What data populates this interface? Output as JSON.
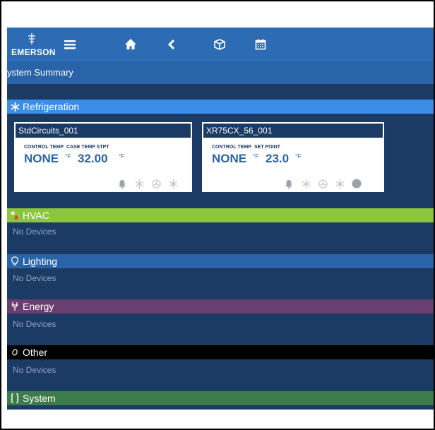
{
  "brand": {
    "name": "EMERSON"
  },
  "topbar": {
    "icons": [
      "menu-icon",
      "home-icon",
      "back-icon",
      "box-icon",
      "calendar-icon"
    ]
  },
  "page": {
    "title": "ystem Summary"
  },
  "sections": {
    "refrigeration": {
      "label": "Refrigeration",
      "color": "#3b8de6"
    },
    "hvac": {
      "label": "HVAC",
      "empty": "No Devices",
      "color": "#8cc63e"
    },
    "lighting": {
      "label": "Lighting",
      "empty": "No Devices",
      "color": "#2a64a8"
    },
    "energy": {
      "label": "Energy",
      "empty": "No Devices",
      "color": "#6a3e6e"
    },
    "other": {
      "label": "Other",
      "empty": "No Devices",
      "color": "#000000"
    },
    "system": {
      "label": "System",
      "color": "#3c7b4a"
    }
  },
  "cards": [
    {
      "title": "StdCircuits_001",
      "label1": "CONTROL TEMP",
      "label2": "CASE TEMP STPT",
      "value1": "NONE",
      "unit1": "°F",
      "value2": "32.00",
      "unit2": "°F",
      "icons": [
        "bell-icon",
        "defrost-icon",
        "fan-icon",
        "clean-icon"
      ]
    },
    {
      "title": "XR75CX_56_001",
      "label1": "CONTROL TEMP",
      "label2": "SET POINT",
      "value1": "NONE",
      "unit1": "°F",
      "value2": "23.0",
      "unit2": "°F",
      "icons": [
        "bell-icon",
        "defrost-icon",
        "fan-icon",
        "clean-icon",
        "status-icon"
      ]
    }
  ]
}
